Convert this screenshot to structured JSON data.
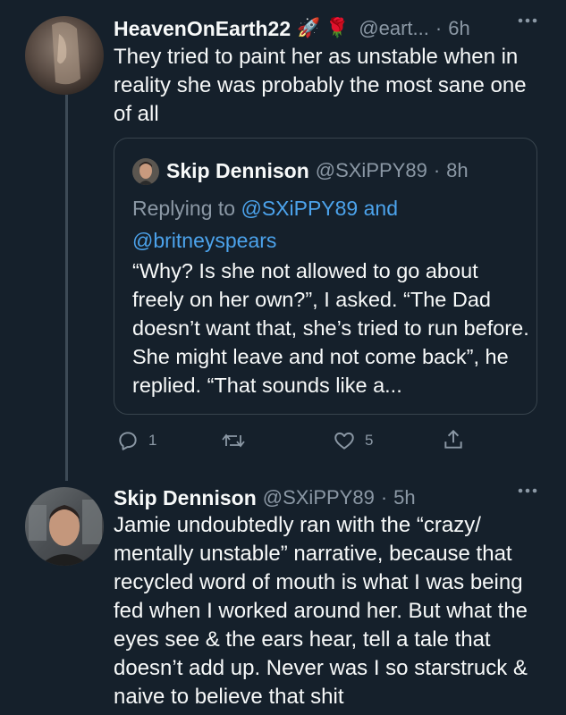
{
  "tweet1": {
    "display_name": "HeavenOnEarth22",
    "name_emojis": "🚀 🌹",
    "handle": "@eart...",
    "separator": "·",
    "time": "6h",
    "text": "They tried to paint her as unstable when in reality she was probably the most sane one of all",
    "quote": {
      "display_name": "Skip Dennison",
      "handle": "@SXiPPY89",
      "separator": "·",
      "time": "8h",
      "replying_prefix": "Replying to",
      "replying_user1": "@SXiPPY89",
      "replying_and": "and",
      "replying_user2": "@britneyspears",
      "text": "“Why? Is she not allowed to go about freely on her own?”, I asked. “The Dad doesn’t want that, she’s tried to run before. She might leave and not come back”, he replied. “That sounds like a..."
    },
    "actions": {
      "reply_count": "1",
      "retweet_count": "",
      "like_count": "5"
    }
  },
  "tweet2": {
    "display_name": "Skip Dennison",
    "handle": "@SXiPPY89",
    "separator": "·",
    "time": "5h",
    "text": "Jamie undoubtedly ran with the “crazy/ mentally unstable” narrative, because that recycled word of mouth is what I was being fed when I worked around her. But what the eyes see & the ears hear, tell a tale that doesn’t add up. Never was I so starstruck & naive to believe that shit"
  },
  "icons": {
    "more": "more-horizontal-icon",
    "reply": "reply-icon",
    "retweet": "retweet-icon",
    "like": "heart-icon",
    "share": "share-icon"
  },
  "colors": {
    "background": "#15202b",
    "text": "#f7f9f9",
    "muted": "#8b98a5",
    "link": "#4ca3ec",
    "border": "#38444d"
  }
}
